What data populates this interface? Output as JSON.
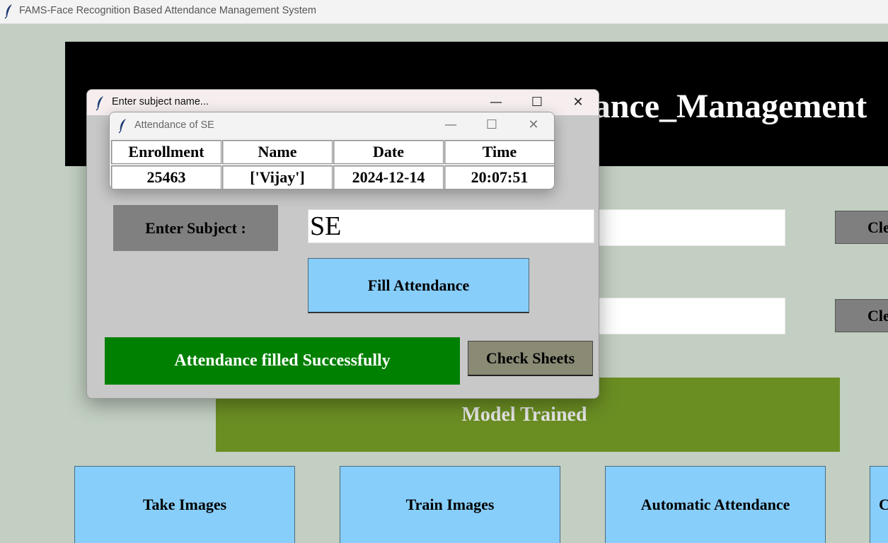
{
  "main_window": {
    "title": "FAMS-Face Recognition Based Attendance Management System",
    "banner_text": "dance_Management",
    "clear_button_1": "Cle",
    "clear_button_2": "Cle",
    "model_status": "Model Trained",
    "buttons": {
      "take_images": "Take Images",
      "train_images": "Train Images",
      "automatic_attendance": "Automatic Attendance",
      "partial": "C"
    }
  },
  "subject_dialog": {
    "title": "Enter subject name...",
    "controls": {
      "minimize": "—",
      "maximize": "☐",
      "close": "✕"
    },
    "label": "Enter Subject :",
    "input_value": "SE",
    "fill_button": "Fill Attendance",
    "status_message": "Attendance filled Successfully",
    "check_sheets_button": "Check Sheets"
  },
  "attendance_window": {
    "title": "Attendance of SE",
    "controls": {
      "minimize": "—",
      "maximize": "☐",
      "close": "✕"
    },
    "headers": [
      "Enrollment",
      "Name",
      "Date",
      "Time"
    ],
    "rows": [
      [
        "25463",
        "['Vijay']",
        "2024-12-14",
        "20:07:51"
      ]
    ]
  },
  "colors": {
    "background": "#c2cfc2",
    "banner": "#000000",
    "model_status_bg": "#6b8e23",
    "button_blue": "#87cefa",
    "success_green": "#008000"
  },
  "icons": {
    "app_icon": "feather-icon"
  }
}
